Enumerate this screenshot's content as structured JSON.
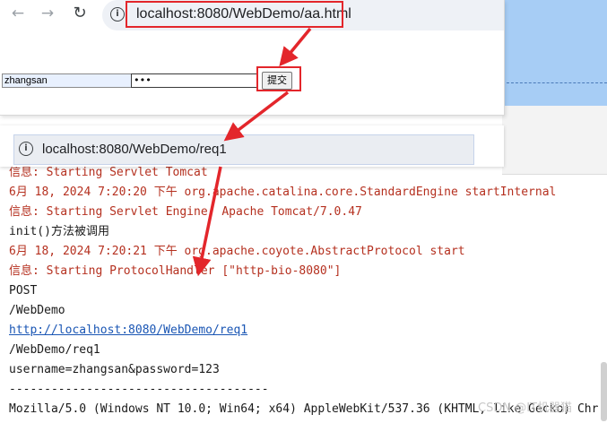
{
  "browser1": {
    "url": "localhost:8080/WebDemo/aa.html",
    "nav_icons": [
      "arrow-back-icon",
      "arrow-forward-icon",
      "reload-icon",
      "info-icon"
    ]
  },
  "form": {
    "username_value": "zhangsan",
    "password_mask": "•••",
    "submit_label": "提交"
  },
  "browser2": {
    "url": "localhost:8080/WebDemo/req1"
  },
  "console": {
    "lines": [
      {
        "text": "信息: Starting Servlet Tomcat",
        "style": "red"
      },
      {
        "text": "6月 18, 2024 7:20:20 下午 org.apache.catalina.core.StandardEngine startInternal",
        "style": "red"
      },
      {
        "text": "信息: Starting Servlet Engine: Apache Tomcat/7.0.47",
        "style": "red"
      },
      {
        "text": "init()方法被调用",
        "style": "black"
      },
      {
        "text": "6月 18, 2024 7:20:21 下午 org.apache.coyote.AbstractProtocol start",
        "style": "red"
      },
      {
        "text": "信息: Starting ProtocolHandler [\"http-bio-8080\"]",
        "style": "red"
      },
      {
        "text": "POST",
        "style": "black"
      },
      {
        "text": "/WebDemo",
        "style": "black"
      },
      {
        "text": "http://localhost:8080/WebDemo/req1",
        "style": "link"
      },
      {
        "text": "/WebDemo/req1",
        "style": "black"
      },
      {
        "text": "username=zhangsan&password=123",
        "style": "black"
      },
      {
        "text": "-------------------------------------",
        "style": "black"
      },
      {
        "text": "Mozilla/5.0 (Windows NT 10.0; Win64; x64) AppleWebKit/537.36 (KHTML, like Gecko) Chr",
        "style": "black"
      }
    ]
  },
  "watermark": "CSDN @IT机器猫",
  "colors": {
    "annotation_red": "#e3262b",
    "log_red": "#b5301f",
    "link_blue": "#1a56b4",
    "ide_blue": "#a7cdf5"
  }
}
